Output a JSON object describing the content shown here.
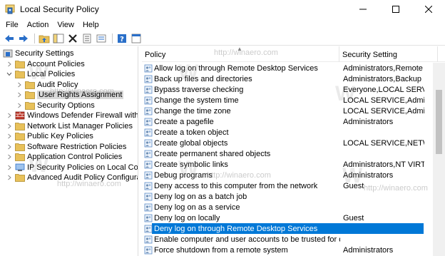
{
  "window": {
    "title": "Local Security Policy",
    "minimize_glyph": "—",
    "maximize_glyph": "☐",
    "close_glyph": "✕"
  },
  "menu": {
    "items": [
      "File",
      "Action",
      "View",
      "Help"
    ]
  },
  "toolbar": {
    "buttons": [
      "back-icon",
      "forward-icon",
      "up-folder-icon",
      "show-tree-icon",
      "delete-icon",
      "properties-icon",
      "export-icon",
      "help-icon",
      "console-icon"
    ]
  },
  "tree": {
    "items": [
      {
        "label": "Security Settings",
        "level": 0,
        "expanded": true,
        "icon": "security-settings-icon"
      },
      {
        "label": "Account Policies",
        "level": 1,
        "expanded": false,
        "icon": "folder-icon"
      },
      {
        "label": "Local Policies",
        "level": 1,
        "expanded": true,
        "icon": "folder-icon"
      },
      {
        "label": "Audit Policy",
        "level": 2,
        "expanded": false,
        "icon": "folder-icon"
      },
      {
        "label": "User Rights Assignment",
        "level": 2,
        "expanded": false,
        "icon": "folder-icon",
        "selected": true
      },
      {
        "label": "Security Options",
        "level": 2,
        "expanded": false,
        "icon": "folder-icon"
      },
      {
        "label": "Windows Defender Firewall with Adva",
        "level": 1,
        "expanded": false,
        "icon": "firewall-icon"
      },
      {
        "label": "Network List Manager Policies",
        "level": 1,
        "expanded": false,
        "icon": "folder-icon"
      },
      {
        "label": "Public Key Policies",
        "level": 1,
        "expanded": false,
        "icon": "folder-icon"
      },
      {
        "label": "Software Restriction Policies",
        "level": 1,
        "expanded": false,
        "icon": "folder-icon"
      },
      {
        "label": "Application Control Policies",
        "level": 1,
        "expanded": false,
        "icon": "folder-icon"
      },
      {
        "label": "IP Security Policies on Local Compute",
        "level": 1,
        "expanded": false,
        "icon": "ipsec-icon"
      },
      {
        "label": "Advanced Audit Policy Configuration",
        "level": 1,
        "expanded": false,
        "icon": "folder-icon"
      }
    ]
  },
  "list": {
    "columns": [
      "Policy",
      "Security Setting"
    ],
    "rows": [
      {
        "policy": "Allow log on through Remote Desktop Services",
        "setting": "Administrators,Remote ..."
      },
      {
        "policy": "Back up files and directories",
        "setting": "Administrators,Backup ..."
      },
      {
        "policy": "Bypass traverse checking",
        "setting": "Everyone,LOCAL SERVIC..."
      },
      {
        "policy": "Change the system time",
        "setting": "LOCAL SERVICE,Admini..."
      },
      {
        "policy": "Change the time zone",
        "setting": "LOCAL SERVICE,Admini..."
      },
      {
        "policy": "Create a pagefile",
        "setting": "Administrators"
      },
      {
        "policy": "Create a token object",
        "setting": ""
      },
      {
        "policy": "Create global objects",
        "setting": "LOCAL SERVICE,NETWO..."
      },
      {
        "policy": "Create permanent shared objects",
        "setting": ""
      },
      {
        "policy": "Create symbolic links",
        "setting": "Administrators,NT VIRTU..."
      },
      {
        "policy": "Debug programs",
        "setting": "Administrators"
      },
      {
        "policy": "Deny access to this computer from the network",
        "setting": "Guest"
      },
      {
        "policy": "Deny log on as a batch job",
        "setting": ""
      },
      {
        "policy": "Deny log on as a service",
        "setting": ""
      },
      {
        "policy": "Deny log on locally",
        "setting": "Guest"
      },
      {
        "policy": "Deny log on through Remote Desktop Services",
        "setting": "",
        "selected": true
      },
      {
        "policy": "Enable computer and user accounts to be trusted for delega...",
        "setting": ""
      },
      {
        "policy": "Force shutdown from a remote system",
        "setting": "Administrators"
      }
    ]
  },
  "watermark": {
    "text": "http://winaero.com"
  },
  "colors": {
    "selection": "#0078d7",
    "folder": "#e8c15a",
    "tree_selection": "#d9d9d9"
  }
}
